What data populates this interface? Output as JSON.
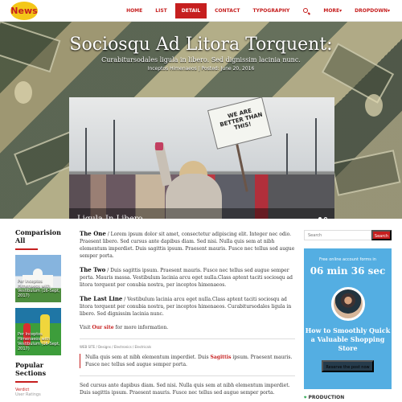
{
  "header": {
    "logo": "News",
    "nav": [
      "HOME",
      "LIST",
      "DETAIL",
      "CONTACT",
      "TYPOGRAPHY",
      "MORE▾",
      "DROPDOWN▾"
    ]
  },
  "hero": {
    "title": "Sociosqu Ad Litora Torquent:",
    "subtitle": "Curabitursodales ligula in libero. Sed dignissim lacinia nunc.",
    "meta": "Inceptos Himenaeos | Posted: June 20, 2016",
    "image_caption": "Ligula In Libero",
    "sign_text": "WE ARE BETTER THAN THIS!"
  },
  "left": {
    "comparison_title": "Comparision All",
    "items": [
      "Per Inceptos Himenaeos with Vestibulum (16-Sept, 2017)",
      "Per Inceptos Himenaeos with Vestibulum (16-Sept, 2017)"
    ],
    "popular_title": "Popular Sections",
    "popular_items": [
      "Verdict",
      "User Ratings"
    ]
  },
  "main": {
    "sections": [
      {
        "title": "The One",
        "text": " / Lorem ipsum dolor sit amet, consectetur adipiscing elit. Integer nec odio. Praesent libero. Sed cursus ante dapibus diam. Sed nisi. Nulla quis sem at nibh elementum imperdiet. Duis sagittis ipsum. Praesent mauris. Fusce nec tellus sed augue semper porta."
      },
      {
        "title": "The Two",
        "text": " / Duis sagittis ipsum. Praesent mauris. Fusce nec tellus sed augue semper porta. Mauris massa. Vestibulum lacinia arcu eget nulla.Class aptent taciti sociosqu ad litora torquent per conubia nostra, per inceptos himenaeos."
      },
      {
        "title": "The Last Line",
        "text": " / Vestibulum lacinia arcu eget nulla.Class aptent taciti sociosqu ad litora torquent per conubia nostra, per inceptos himenaeos. Curabitursodales ligula in libero. Sed dignissim lacinia nunc."
      }
    ],
    "visit_prefix": "Visit ",
    "visit_link": "Our site",
    "visit_suffix": " for more information.",
    "breadcrumb": "WEB SITE  /  Designs  /  Electronics  /  Electricals",
    "quote_before": "Nulla quis sem at nibh elementum imperdiet. Duis ",
    "quote_red": "Sagittis",
    "quote_after": " ipsum. Praesent mauris. Fusce nec tellus sed augue semper porta.",
    "final_text": "Sed cursus ante dapibus diam. Sed nisi. Nulla quis sem at nibh elementum imperdiet. Duis sagittis ipsum. Praesent mauris. Fusce nec tellus sed augue semper porta."
  },
  "right": {
    "search_placeholder": "Search",
    "search_button": "Search",
    "promo_small": "Free online account forms in",
    "promo_timer": "06 min 36 sec",
    "promo_title": "How to Smoothly Quick a Valuable Shopping Store",
    "promo_button": "Reserve the post now",
    "production": "PRODUCTION"
  },
  "icons": [
    "search-icon",
    "location-icon"
  ],
  "colors": {
    "brand_red": "#c61f1f",
    "logo_yellow": "#f4c718",
    "promo_blue": "#54aee2"
  }
}
